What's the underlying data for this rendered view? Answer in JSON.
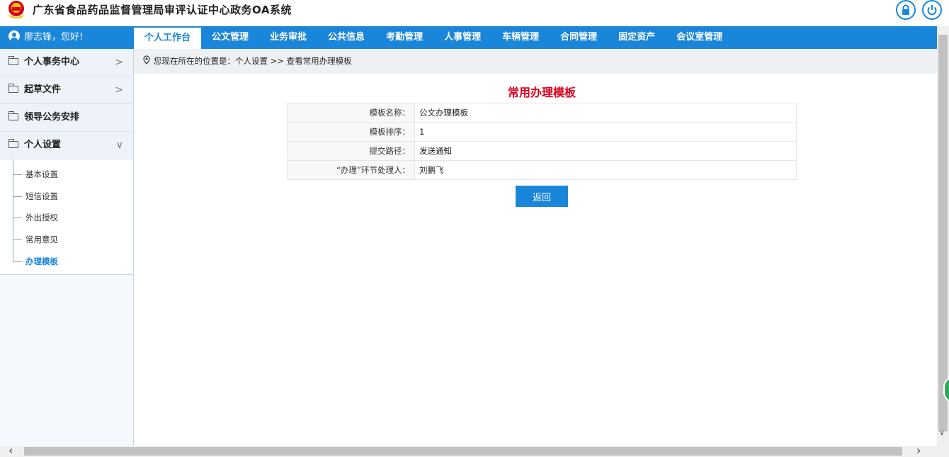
{
  "header": {
    "title": "广东省食品药品监督管理局审评认证中心政务OA系统",
    "emblem_icon": "national-emblem-icon",
    "lock_icon": "lock-icon",
    "power_icon": "power-icon"
  },
  "user": {
    "greeting": "廖志锋，您好!"
  },
  "tabs": [
    {
      "label": "个人工作台",
      "active": true
    },
    {
      "label": "公文管理"
    },
    {
      "label": "业务审批"
    },
    {
      "label": "公共信息"
    },
    {
      "label": "考勤管理"
    },
    {
      "label": "人事管理"
    },
    {
      "label": "车辆管理"
    },
    {
      "label": "合同管理"
    },
    {
      "label": "固定资产"
    },
    {
      "label": "会议室管理"
    }
  ],
  "sidebar": {
    "items": [
      {
        "label": "个人事务中心"
      },
      {
        "label": "起草文件"
      },
      {
        "label": "领导公务安排"
      },
      {
        "label": "个人设置",
        "expanded": true
      }
    ],
    "sub_items": [
      {
        "label": "基本设置"
      },
      {
        "label": "短信设置"
      },
      {
        "label": "外出授权"
      },
      {
        "label": "常用意见"
      },
      {
        "label": "办理模板",
        "active": true
      }
    ]
  },
  "breadcrumb": {
    "text": "您现在所在的位置是：个人设置 >> 查看常用办理模板"
  },
  "page": {
    "title": "常用办理模板",
    "rows": [
      {
        "label": "模板名称：",
        "value": "公文办理模板"
      },
      {
        "label": "模板排序：",
        "value": "1"
      },
      {
        "label": "提交路径：",
        "value": "发送通知"
      },
      {
        "label": "“办理”环节处理人：",
        "value": "刘鹏飞"
      }
    ],
    "back_label": "返回"
  },
  "colors": {
    "primary": "#1a86d9",
    "title_red": "#d8001d"
  }
}
